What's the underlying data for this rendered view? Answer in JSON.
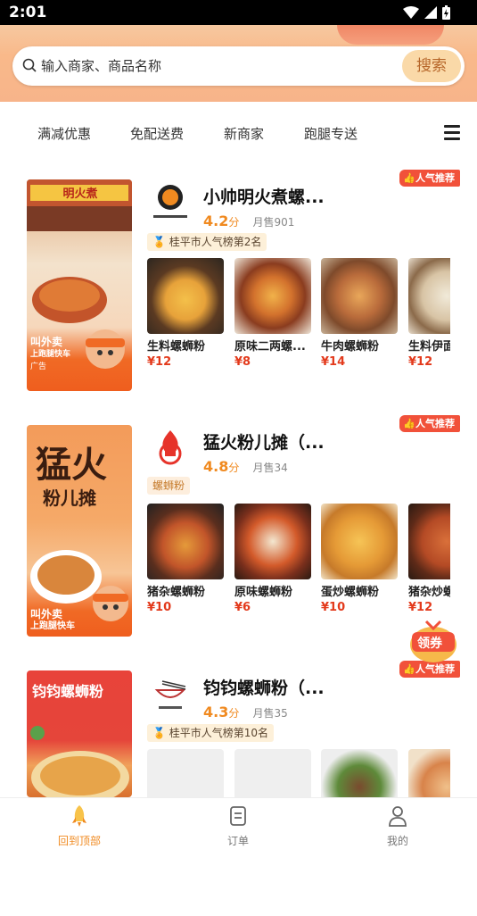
{
  "status_bar": {
    "time": "2:01"
  },
  "search": {
    "placeholder": "输入商家、商品名称",
    "button_label": "搜索"
  },
  "filter_tabs": [
    "满减优惠",
    "免配送费",
    "新商家",
    "跑腿专送"
  ],
  "colors": {
    "accent": "#f08a20",
    "price": "#e33a1c",
    "badge": "#f1513a"
  },
  "shops": [
    {
      "name": "小帅明火煮螺...",
      "badge": "人气推荐",
      "score": "4.2",
      "score_unit": "分",
      "sales": "月售901",
      "tag": "桂平市人气榜第2名",
      "poster_caption_1": "叫外卖",
      "poster_caption_2": "上跑腿快车",
      "poster_ad": "广告",
      "dishes": [
        {
          "name": "生料螺蛳粉",
          "price": "¥12"
        },
        {
          "name": "原味二两螺...",
          "price": "¥8"
        },
        {
          "name": "牛肉螺蛳粉",
          "price": "¥14"
        },
        {
          "name": "生料伊面",
          "price": "¥12"
        }
      ]
    },
    {
      "name": "猛火粉儿摊（...",
      "badge": "人气推荐",
      "score": "4.8",
      "score_unit": "分",
      "sales": "月售34",
      "tag": "螺蛳粉",
      "poster_title": "猛火",
      "poster_sub": "粉儿摊",
      "poster_caption_1": "叫外卖",
      "poster_caption_2": "上跑腿快车",
      "dishes": [
        {
          "name": "猪杂螺蛳粉",
          "price": "¥10"
        },
        {
          "name": "原味螺蛳粉",
          "price": "¥6"
        },
        {
          "name": "蛋炒螺蛳粉",
          "price": "¥10"
        },
        {
          "name": "猪杂炒螺",
          "price": "¥12"
        }
      ]
    },
    {
      "name": "钧钧螺蛳粉（...",
      "badge": "人气推荐",
      "score": "4.3",
      "score_unit": "分",
      "sales": "月售35",
      "tag": "桂平市人气榜第10名",
      "poster_title": "钧钧螺蛳粉",
      "dishes": [
        {
          "name": "",
          "price": ""
        },
        {
          "name": "",
          "price": ""
        },
        {
          "name": "",
          "price": ""
        },
        {
          "name": "",
          "price": ""
        }
      ]
    }
  ],
  "coupon_label": "领券",
  "bottom_nav": [
    {
      "label": "回到顶部",
      "icon": "rocket-icon"
    },
    {
      "label": "订单",
      "icon": "order-icon"
    },
    {
      "label": "我的",
      "icon": "user-icon"
    }
  ]
}
